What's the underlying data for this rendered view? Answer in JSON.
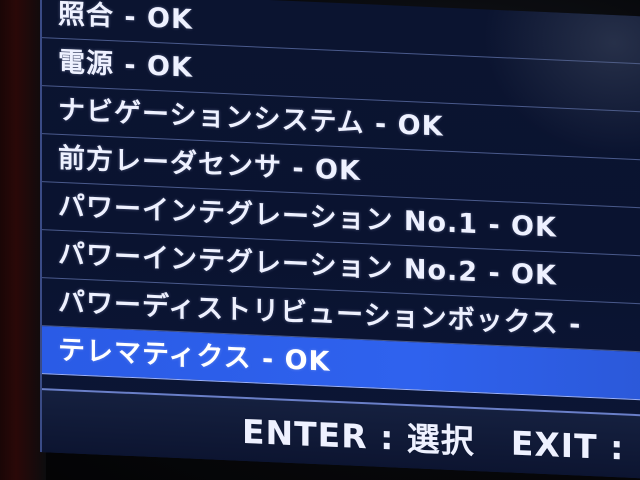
{
  "menu": {
    "items": [
      {
        "label": "照合 - OK",
        "selected": false
      },
      {
        "label": "電源 - OK",
        "selected": false
      },
      {
        "label": "ナビゲーションシステム - OK",
        "selected": false
      },
      {
        "label": "前方レーダセンサ - OK",
        "selected": false
      },
      {
        "label": "パワーインテグレーション No.1 - OK",
        "selected": false
      },
      {
        "label": "パワーインテグレーション No.2 - OK",
        "selected": false
      },
      {
        "label": "パワーディストリビューションボックス -",
        "selected": false
      },
      {
        "label": "テレマティクス - OK",
        "selected": true
      }
    ]
  },
  "footer": {
    "enter_hint": "ENTER : 選択",
    "exit_hint": "EXIT :"
  },
  "colors": {
    "screen_background": "#0b1430",
    "selection_highlight": "#2f62ee",
    "text": "#eef1ff",
    "divider": "#4a5a8c"
  }
}
